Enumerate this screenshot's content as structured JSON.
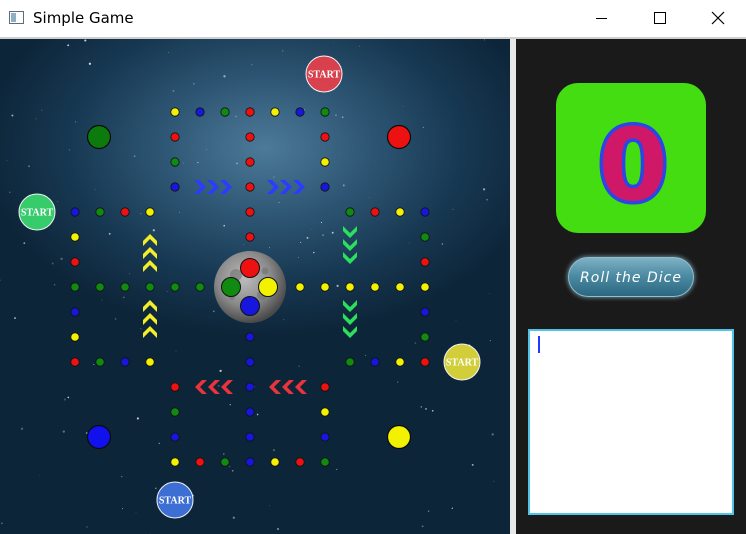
{
  "window": {
    "title": "Simple Game",
    "controls": [
      "minimize-icon",
      "maximize-icon",
      "close-icon"
    ]
  },
  "board": {
    "start_label": "START",
    "start_markers": [
      {
        "color": "red",
        "hex": "#e2404c"
      },
      {
        "color": "green",
        "hex": "#39d46e"
      },
      {
        "color": "yellow",
        "hex": "#ddd83a"
      },
      {
        "color": "blue",
        "hex": "#3f72dd"
      }
    ],
    "home_tokens": [
      {
        "color": "green",
        "hex": "#0c7a0c"
      },
      {
        "color": "red",
        "hex": "#ee1111"
      },
      {
        "color": "blue",
        "hex": "#1111ee"
      },
      {
        "color": "yellow",
        "hex": "#f2f200"
      }
    ],
    "center_tokens": [
      "red",
      "green",
      "yellow",
      "blue"
    ],
    "direction_arrows": [
      {
        "color": "blue",
        "direction": "right"
      },
      {
        "color": "green",
        "direction": "down"
      },
      {
        "color": "red",
        "direction": "left"
      },
      {
        "color": "yellow",
        "direction": "up"
      }
    ],
    "colors": {
      "red": "#ee1111",
      "green": "#108a10",
      "blue": "#1616dd",
      "yellow": "#f2f200"
    }
  },
  "dice": {
    "value": "0",
    "face_color": "#43dd12",
    "digit_fill": "#d01868",
    "digit_outline": "#2a46e6"
  },
  "controls": {
    "roll_label": "Roll the Dice"
  },
  "log": {
    "text": ""
  }
}
